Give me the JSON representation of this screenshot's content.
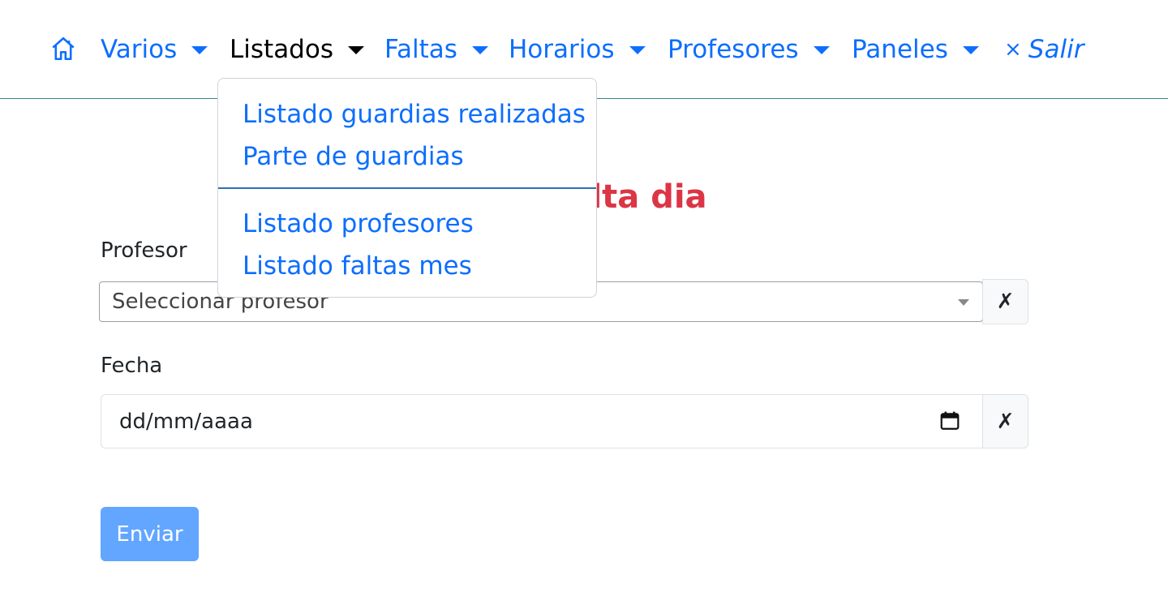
{
  "navbar": {
    "home_icon": "home-icon",
    "items": [
      {
        "label": "Varios"
      },
      {
        "label": "Listados"
      },
      {
        "label": "Faltas"
      },
      {
        "label": "Horarios"
      },
      {
        "label": "Profesores"
      },
      {
        "label": "Paneles"
      }
    ],
    "active_item": "Listados",
    "logout": {
      "icon": "×",
      "label": "Salir"
    }
  },
  "dropdown": {
    "group1": [
      "Listado guardias realizadas",
      "Parte de guardias"
    ],
    "group2": [
      "Listado profesores",
      "Listado faltas mes"
    ]
  },
  "main": {
    "title_visible": "lta dia",
    "profesor": {
      "label": "Profesor",
      "selected": "Seleccionar profesor",
      "clear": "✗"
    },
    "fecha": {
      "label": "Fecha",
      "value": "dd/mm/aaaa",
      "clear": "✗"
    },
    "submit_label": "Enviar"
  },
  "colors": {
    "link": "#0d6efd",
    "title": "#dc3545",
    "submit_bg": "#62a6ff",
    "nav_border": "#2f8a85"
  }
}
